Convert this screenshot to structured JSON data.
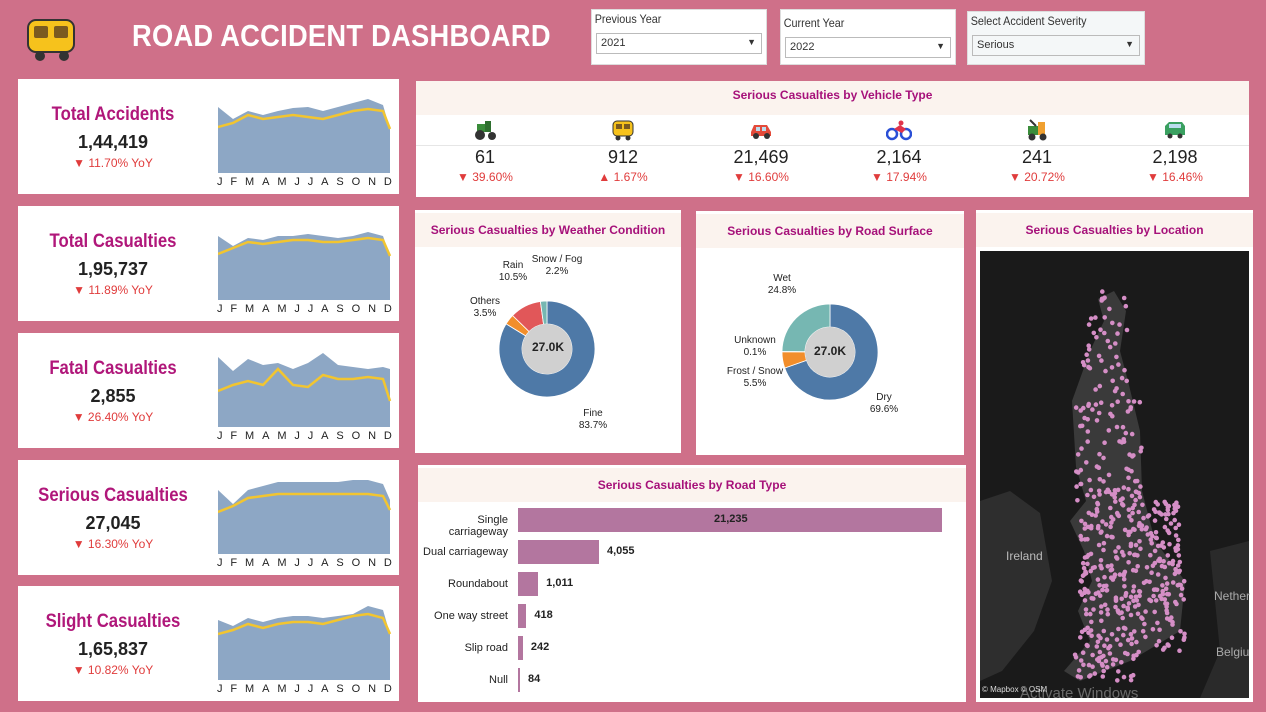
{
  "header": {
    "title": "ROAD ACCIDENT DASHBOARD",
    "logo_icon": "bus-icon"
  },
  "filters": {
    "previous_year": {
      "label": "Previous Year",
      "value": "2021"
    },
    "current_year": {
      "label": "Current Year",
      "value": "2022"
    },
    "severity": {
      "label": "Select Accident Severity",
      "value": "Serious"
    }
  },
  "kpis": [
    {
      "title": "Total Accidents",
      "value": "1,44,419",
      "yoy": "▼ 11.70% YoY"
    },
    {
      "title": "Total Casualties",
      "value": "1,95,737",
      "yoy": "▼ 11.89%  YoY"
    },
    {
      "title": "Fatal Casualties",
      "value": "2,855",
      "yoy": "▼ 26.40% YoY"
    },
    {
      "title": "Serious Casualties",
      "value": "27,045",
      "yoy": "▼ 16.30% YoY"
    },
    {
      "title": "Slight Casualties",
      "value": "1,65,837",
      "yoy": "▼ 10.82% YoY"
    }
  ],
  "months": [
    "J",
    "F",
    "M",
    "A",
    "M",
    "J",
    "J",
    "A",
    "S",
    "O",
    "N",
    "D"
  ],
  "vehicle": {
    "title": "Serious Casualties by Vehicle Type",
    "items": [
      {
        "icon": "tractor-icon",
        "value": "61",
        "change": "▼ 39.60%"
      },
      {
        "icon": "bus-icon",
        "value": "912",
        "change": "▲ 1.67%"
      },
      {
        "icon": "car-icon",
        "value": "21,469",
        "change": "▼ 16.60%"
      },
      {
        "icon": "motorcycle-icon",
        "value": "2,164",
        "change": "▼ 17.94%"
      },
      {
        "icon": "other-vehicle-icon",
        "value": "241",
        "change": "▼ 20.72%"
      },
      {
        "icon": "van-icon",
        "value": "2,198",
        "change": "▼ 16.46%"
      }
    ]
  },
  "weather": {
    "title": "Serious Casualties by Weather Condition",
    "center": "27.0K",
    "slices": [
      {
        "name": "Fine",
        "pct": "83.7%"
      },
      {
        "name": "Others",
        "pct": "3.5%"
      },
      {
        "name": "Rain",
        "pct": "10.5%"
      },
      {
        "name": "Snow / Fog",
        "pct": "2.2%"
      }
    ]
  },
  "surface": {
    "title": "Serious Casualties by Road Surface",
    "center": "27.0K",
    "slices": [
      {
        "name": "Dry",
        "pct": "69.6%"
      },
      {
        "name": "Frost / Snow",
        "pct": "5.5%"
      },
      {
        "name": "Unknown",
        "pct": "0.1%"
      },
      {
        "name": "Wet",
        "pct": "24.8%"
      }
    ]
  },
  "location": {
    "title": "Serious Casualties by Location",
    "attribution": "© Mapbox © OSM",
    "ireland": "Ireland",
    "neth": "Nether",
    "belg": "Belgiu",
    "watermark": "Activate Windows"
  },
  "roadtype": {
    "title": "Serious Casualties by Road Type",
    "rows": [
      {
        "name": "Single carriageway",
        "value": "21,235"
      },
      {
        "name": "Dual carriageway",
        "value": "4,055"
      },
      {
        "name": "Roundabout",
        "value": "1,011"
      },
      {
        "name": "One way street",
        "value": "418"
      },
      {
        "name": "Slip road",
        "value": "242"
      },
      {
        "name": "Null",
        "value": "84"
      }
    ]
  },
  "chart_data": [
    {
      "type": "pie",
      "title": "Serious Casualties by Weather Condition",
      "categories": [
        "Fine",
        "Others",
        "Rain",
        "Snow / Fog"
      ],
      "values": [
        83.7,
        3.5,
        10.5,
        2.2
      ],
      "colors": [
        "#4e79a7",
        "#f28e2b",
        "#e15759",
        "#76b7b2"
      ]
    },
    {
      "type": "pie",
      "title": "Serious Casualties by Road Surface",
      "categories": [
        "Dry",
        "Frost / Snow",
        "Unknown",
        "Wet"
      ],
      "values": [
        69.6,
        5.5,
        0.1,
        24.8
      ],
      "colors": [
        "#4e79a7",
        "#f28e2b",
        "#e15759",
        "#76b7b2"
      ]
    },
    {
      "type": "bar",
      "title": "Serious Casualties by Road Type",
      "categories": [
        "Single carriageway",
        "Dual carriageway",
        "Roundabout",
        "One way street",
        "Slip road",
        "Null"
      ],
      "values": [
        21235,
        4055,
        1011,
        418,
        242,
        84
      ],
      "color": "#b3769f"
    }
  ]
}
